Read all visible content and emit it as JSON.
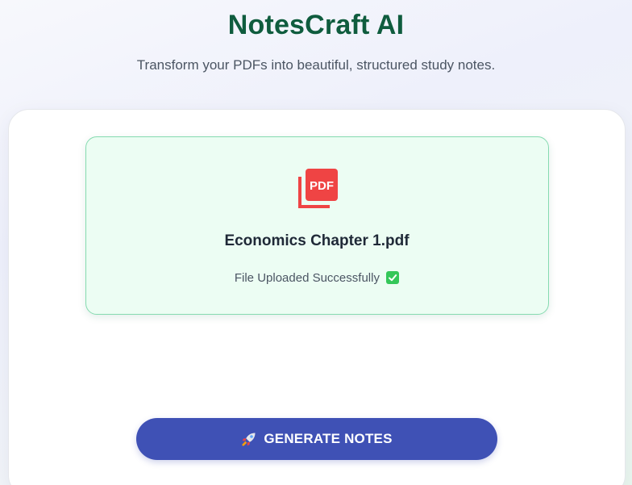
{
  "header": {
    "title": "NotesCraft AI",
    "tagline": "Transform your PDFs into beautiful, structured study notes."
  },
  "upload": {
    "icon": "pdf-file-icon",
    "icon_label": "PDF",
    "file_name": "Economics Chapter 1.pdf",
    "status_text": "File Uploaded Successfully",
    "status_icon": "check-mark-icon"
  },
  "actions": {
    "generate_icon": "rocket-icon",
    "generate_label": "GENERATE NOTES"
  },
  "colors": {
    "title": "#0f5c3e",
    "upload_bg": "#ecfdf3",
    "upload_border": "#86dbb0",
    "pdf_red": "#ef4444",
    "button": "#3f51b5",
    "success": "#34c759"
  }
}
